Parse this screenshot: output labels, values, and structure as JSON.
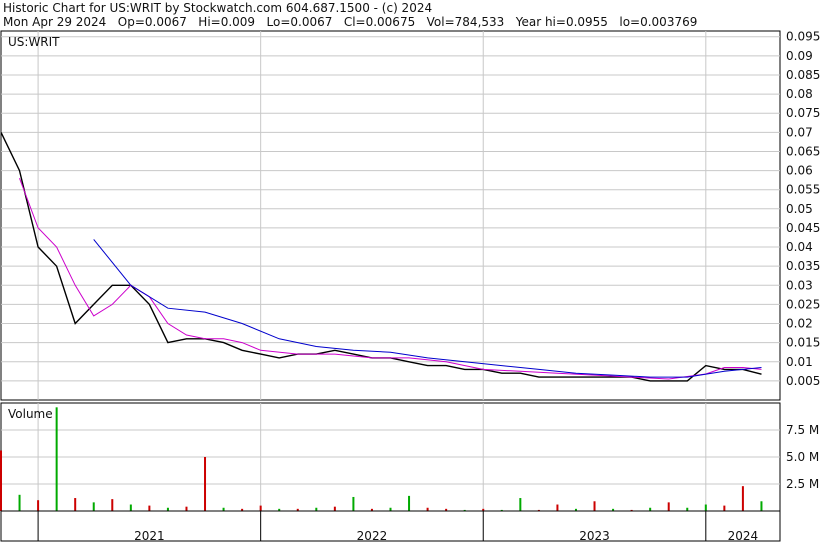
{
  "header": {
    "line1": "Historic Chart for US:WRIT by Stockwatch.com 604.687.1500 - (c) 2024",
    "line2": "Mon Apr 29 2024   Op=0.0067   Hi=0.009   Lo=0.0067   Cl=0.00675   Vol=784,533   Year hi=0.0955   lo=0.003769"
  },
  "colors": {
    "background": "#ffffff",
    "grid": "#c8c8c8",
    "price_bar": "#000000",
    "price_bar_down": "#cc0000",
    "ma_short": "#cc00cc",
    "ma_long": "#0000cc",
    "volume_up": "#00aa00",
    "volume_down": "#cc0000"
  },
  "chart_data": [
    {
      "type": "line",
      "panel": "price",
      "label": "US:WRIT",
      "y_ticks": [
        "0.095",
        "0.09",
        "0.085",
        "0.08",
        "0.075",
        "0.07",
        "0.065",
        "0.06",
        "0.055",
        "0.05",
        "0.045",
        "0.04",
        "0.035",
        "0.03",
        "0.025",
        "0.02",
        "0.015",
        "0.01",
        "0.005"
      ],
      "ylim": [
        0,
        0.0965
      ],
      "x_labels": [
        "2021",
        "2022",
        "2023",
        "2024"
      ],
      "xlim": [
        "2020-11",
        "2024-05"
      ],
      "grid": true,
      "series": [
        {
          "role": "price",
          "x": [
            "2020-11",
            "2020-12",
            "2021-01",
            "2021-02",
            "2021-03",
            "2021-04",
            "2021-05",
            "2021-06",
            "2021-07",
            "2021-08",
            "2021-09",
            "2021-10",
            "2021-11",
            "2021-12",
            "2022-01",
            "2022-02",
            "2022-03",
            "2022-04",
            "2022-05",
            "2022-06",
            "2022-07",
            "2022-08",
            "2022-09",
            "2022-10",
            "2022-11",
            "2022-12",
            "2023-01",
            "2023-02",
            "2023-03",
            "2023-04",
            "2023-05",
            "2023-06",
            "2023-07",
            "2023-08",
            "2023-09",
            "2023-10",
            "2023-11",
            "2023-12",
            "2024-01",
            "2024-02",
            "2024-03",
            "2024-04"
          ],
          "values": [
            0.07,
            0.06,
            0.04,
            0.035,
            0.02,
            0.025,
            0.03,
            0.03,
            0.025,
            0.015,
            0.016,
            0.016,
            0.015,
            0.013,
            0.012,
            0.011,
            0.012,
            0.012,
            0.013,
            0.012,
            0.011,
            0.011,
            0.01,
            0.009,
            0.009,
            0.008,
            0.008,
            0.007,
            0.007,
            0.006,
            0.006,
            0.006,
            0.006,
            0.006,
            0.006,
            0.005,
            0.005,
            0.005,
            0.009,
            0.008,
            0.008,
            0.00675
          ]
        },
        {
          "role": "ma_short",
          "x": [
            "2020-12",
            "2021-01",
            "2021-02",
            "2021-03",
            "2021-04",
            "2021-05",
            "2021-06",
            "2021-07",
            "2021-08",
            "2021-09",
            "2021-10",
            "2021-11",
            "2021-12",
            "2022-01",
            "2022-03",
            "2022-05",
            "2022-07",
            "2022-09",
            "2022-11",
            "2023-01",
            "2023-03",
            "2023-05",
            "2023-07",
            "2023-09",
            "2023-11",
            "2024-01",
            "2024-02",
            "2024-03",
            "2024-04"
          ],
          "values": [
            0.058,
            0.045,
            0.04,
            0.03,
            0.022,
            0.025,
            0.03,
            0.027,
            0.02,
            0.017,
            0.016,
            0.016,
            0.015,
            0.013,
            0.012,
            0.012,
            0.011,
            0.011,
            0.01,
            0.008,
            0.0075,
            0.007,
            0.0065,
            0.006,
            0.0055,
            0.0068,
            0.0085,
            0.0085,
            0.008
          ]
        },
        {
          "role": "ma_long",
          "x": [
            "2021-04",
            "2021-06",
            "2021-08",
            "2021-10",
            "2021-12",
            "2022-02",
            "2022-04",
            "2022-06",
            "2022-08",
            "2022-10",
            "2022-12",
            "2023-02",
            "2023-04",
            "2023-06",
            "2023-08",
            "2023-10",
            "2023-12",
            "2024-02",
            "2024-04"
          ],
          "values": [
            0.042,
            0.03,
            0.024,
            0.023,
            0.02,
            0.016,
            0.014,
            0.013,
            0.0125,
            0.011,
            0.01,
            0.009,
            0.008,
            0.007,
            0.0065,
            0.006,
            0.006,
            0.0075,
            0.0085
          ]
        }
      ]
    },
    {
      "type": "bar",
      "panel": "volume",
      "label": "Volume",
      "y_ticks": [
        "7.5 M",
        "5.0 M",
        "2.5 M"
      ],
      "ylim": [
        0,
        10000000
      ],
      "x": [
        "2020-11",
        "2020-12",
        "2021-01",
        "2021-02",
        "2021-03",
        "2021-04",
        "2021-05",
        "2021-06",
        "2021-07",
        "2021-08",
        "2021-09",
        "2021-10",
        "2021-11",
        "2021-12",
        "2022-01",
        "2022-02",
        "2022-03",
        "2022-04",
        "2022-05",
        "2022-06",
        "2022-07",
        "2022-08",
        "2022-09",
        "2022-10",
        "2022-11",
        "2022-12",
        "2023-01",
        "2023-02",
        "2023-03",
        "2023-04",
        "2023-05",
        "2023-06",
        "2023-07",
        "2023-08",
        "2023-09",
        "2023-10",
        "2023-11",
        "2023-12",
        "2024-01",
        "2024-02",
        "2024-03",
        "2024-04"
      ],
      "values": [
        5600000,
        1500000,
        1000000,
        9600000,
        1200000,
        800000,
        1100000,
        600000,
        500000,
        300000,
        400000,
        5000000,
        300000,
        200000,
        500000,
        200000,
        200000,
        300000,
        400000,
        1300000,
        200000,
        300000,
        1400000,
        300000,
        200000,
        100000,
        200000,
        100000,
        1200000,
        100000,
        600000,
        200000,
        900000,
        200000,
        100000,
        300000,
        800000,
        300000,
        600000,
        500000,
        2300000,
        900000
      ],
      "direction": [
        "down",
        "up",
        "down",
        "up",
        "down",
        "up",
        "down",
        "up",
        "down",
        "up",
        "down",
        "down",
        "up",
        "down",
        "down",
        "up",
        "down",
        "up",
        "down",
        "up",
        "down",
        "up",
        "up",
        "down",
        "down",
        "up",
        "down",
        "up",
        "up",
        "down",
        "down",
        "up",
        "down",
        "up",
        "down",
        "up",
        "down",
        "up",
        "up",
        "down",
        "down",
        "up"
      ]
    }
  ]
}
